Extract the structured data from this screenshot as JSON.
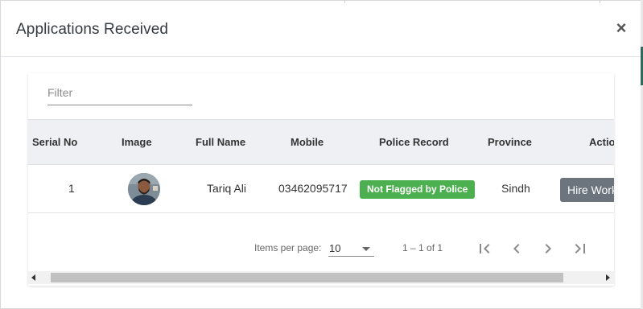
{
  "dialog": {
    "title": "Applications Received",
    "close_icon": "×"
  },
  "filter": {
    "placeholder": "Filter",
    "value": ""
  },
  "table": {
    "columns": [
      "Serial No",
      "Image",
      "Full Name",
      "Mobile",
      "Police Record",
      "Province",
      "Actio"
    ],
    "rows": [
      {
        "serial": "1",
        "image": "avatar",
        "full_name": "Tariq Ali",
        "mobile": "03462095717",
        "police_record": "Not Flagged by Police",
        "province": "Sindh",
        "action": "Hire Work"
      }
    ]
  },
  "paginator": {
    "items_per_page_label": "Items per page:",
    "items_per_page_value": "10",
    "range_label": "1 – 1 of 1",
    "icons": [
      "first-page-icon",
      "previous-page-icon",
      "next-page-icon",
      "last-page-icon"
    ]
  },
  "colors": {
    "badge_green": "#4caf50",
    "action_gray": "#6c757d",
    "header_bg": "#eef0f4"
  }
}
